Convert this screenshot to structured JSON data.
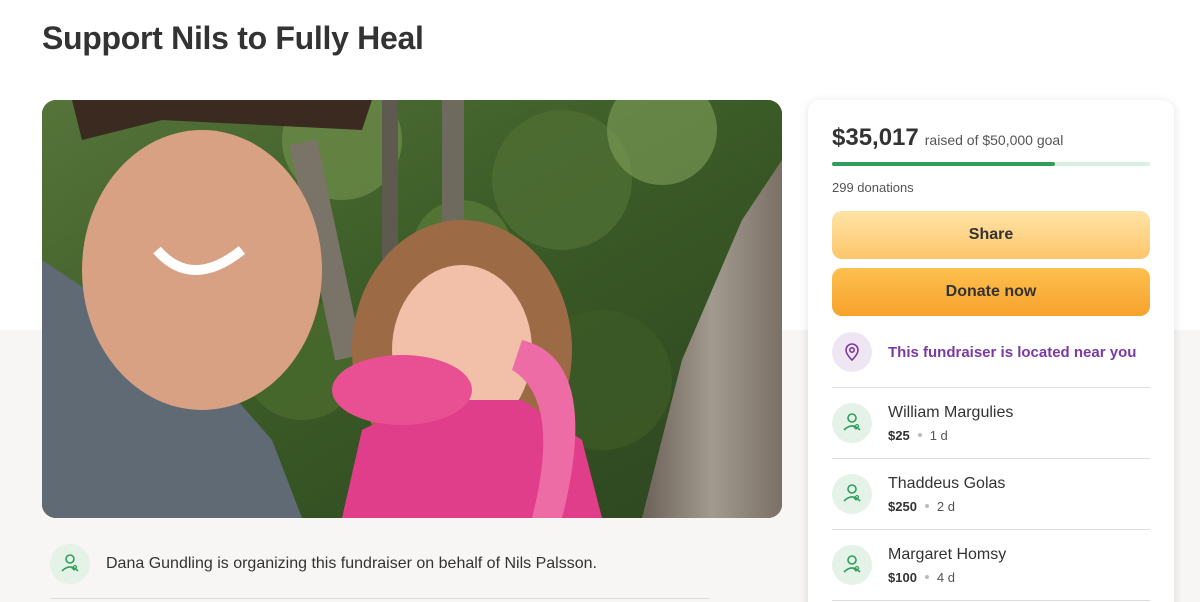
{
  "page": {
    "title": "Support Nils to Fully Heal"
  },
  "organizer": {
    "text": "Dana Gundling is organizing this fundraiser on behalf of Nils Palsson."
  },
  "summary": {
    "amount_raised": "$35,017",
    "goal_text": "raised of $50,000 goal",
    "progress_fraction": 0.70034,
    "donations_count": "299 donations"
  },
  "buttons": {
    "share_label": "Share",
    "donate_label": "Donate now"
  },
  "location": {
    "text": "This fundraiser is located near you",
    "icon": "map-pin-icon"
  },
  "donors": [
    {
      "name": "William Margulies",
      "amount": "$25",
      "time": "1 d"
    },
    {
      "name": "Thaddeus Golas",
      "amount": "$250",
      "time": "2 d"
    },
    {
      "name": "Margaret Homsy",
      "amount": "$100",
      "time": "4 d"
    }
  ],
  "colors": {
    "accent_green": "#2e9e5a",
    "donate_orange": "#f7a22c",
    "share_yellow": "#fdc66b",
    "location_purple": "#7b3aa2"
  }
}
